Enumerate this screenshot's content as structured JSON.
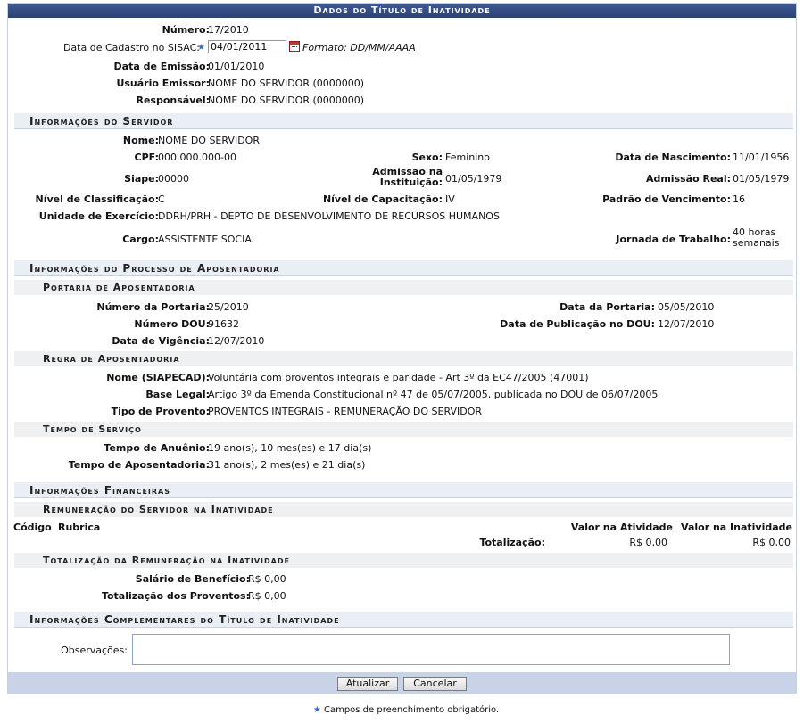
{
  "caption": "Dados do Título de Inatividade",
  "header": {
    "numero_label": "Número:",
    "numero": "17/2010",
    "data_cadastro_label": "Data de Cadastro no SISAC:",
    "data_cadastro_value": "04/01/2011",
    "formato": "Formato: DD/MM/AAAA",
    "data_emissao_label": "Data de Emissão:",
    "data_emissao": "01/01/2010",
    "usuario_label": "Usuário Emissor:",
    "usuario": "NOME DO SERVIDOR (0000000)",
    "responsavel_label": "Responsável:",
    "responsavel": "NOME DO SERVIDOR (0000000)"
  },
  "servidor": {
    "title": "Informações do Servidor",
    "nome_label": "Nome:",
    "nome": "NOME DO SERVIDOR",
    "cpf_label": "CPF:",
    "cpf": "000.000.000-00",
    "sexo_label": "Sexo:",
    "sexo": "Feminino",
    "nasc_label": "Data de Nascimento:",
    "nasc": "11/01/1956",
    "siape_label": "Siape:",
    "siape": "00000",
    "adm_inst_label1": "Admissão na",
    "adm_inst_label2": "Instituição:",
    "adm_inst": "01/05/1979",
    "adm_real_label": "Admissão Real:",
    "adm_real": "01/05/1979",
    "nivel_class_label": "Nível de Classificação:",
    "nivel_class": "C",
    "nivel_cap_label": "Nível de Capacitação:",
    "nivel_cap": "IV",
    "padrao_label": "Padrão de Vencimento:",
    "padrao": "16",
    "unidade_label": "Unidade de Exercício:",
    "unidade": "DDRH/PRH - DEPTO DE DESENVOLVIMENTO DE RECURSOS HUMANOS",
    "cargo_label": "Cargo:",
    "cargo": "ASSISTENTE SOCIAL",
    "jornada_label": "Jornada de Trabalho:",
    "jornada1": "40 horas",
    "jornada2": "semanais"
  },
  "processo": {
    "title": "Informações do Processo de Aposentadoria",
    "portaria_title": "Portaria de Aposentadoria",
    "num_portaria_label": "Número da Portaria:",
    "num_portaria": "25/2010",
    "data_portaria_label": "Data da Portaria:",
    "data_portaria": "05/05/2010",
    "num_dou_label": "Número DOU:",
    "num_dou": "91632",
    "data_pub_label": "Data de Publicação no DOU:",
    "data_pub": "12/07/2010",
    "vigencia_label": "Data de Vigência:",
    "vigencia": "12/07/2010",
    "regra_title": "Regra de Aposentadoria",
    "nome_siapecad_label": "Nome (SIAPECAD):",
    "nome_siapecad": "Voluntária com proventos integrais e paridade - Art 3º da EC47/2005 (47001)",
    "base_legal_label": "Base Legal:",
    "base_legal": "Artigo 3º da Emenda Constitucional nº 47 de 05/07/2005, publicada no DOU de 06/07/2005",
    "tipo_provento_label": "Tipo de Provento:",
    "tipo_provento": "PROVENTOS INTEGRAIS - REMUNERAÇÃO DO SERVIDOR",
    "tempo_title": "Tempo de Serviço",
    "anuenio_label": "Tempo de Anuênio:",
    "anuenio": "19 ano(s), 10 mes(es) e 17 dia(s)",
    "aposent_label": "Tempo de Aposentadoria:",
    "aposent": "31 ano(s), 2 mes(es) e 21 dia(s)"
  },
  "financeiro": {
    "title": "Informações Financeiras",
    "remun_title": "Remuneração do Servidor na Inatividade",
    "col_codigo": "Código",
    "col_rubrica": "Rubrica",
    "col_valor_atividade": "Valor na Atividade",
    "col_valor_inatividade": "Valor na Inatividade",
    "totalizacao_label": "Totalização:",
    "total_atividade": "R$ 0,00",
    "total_inatividade": "R$ 0,00",
    "tot_remun_title": "Totalização da Remuneração na Inatividade",
    "salario_label": "Salário de Benefício:",
    "salario": "R$ 0,00",
    "tot_proventos_label": "Totalização dos Proventos:",
    "tot_proventos": "R$ 0,00"
  },
  "complementares": {
    "title": "Informações Complementares do Título de Inatividade",
    "obs_label": "Observações:"
  },
  "buttons": {
    "atualizar": "Atualizar",
    "cancelar": "Cancelar"
  },
  "required_note": "Campos de preenchimento obrigatório."
}
